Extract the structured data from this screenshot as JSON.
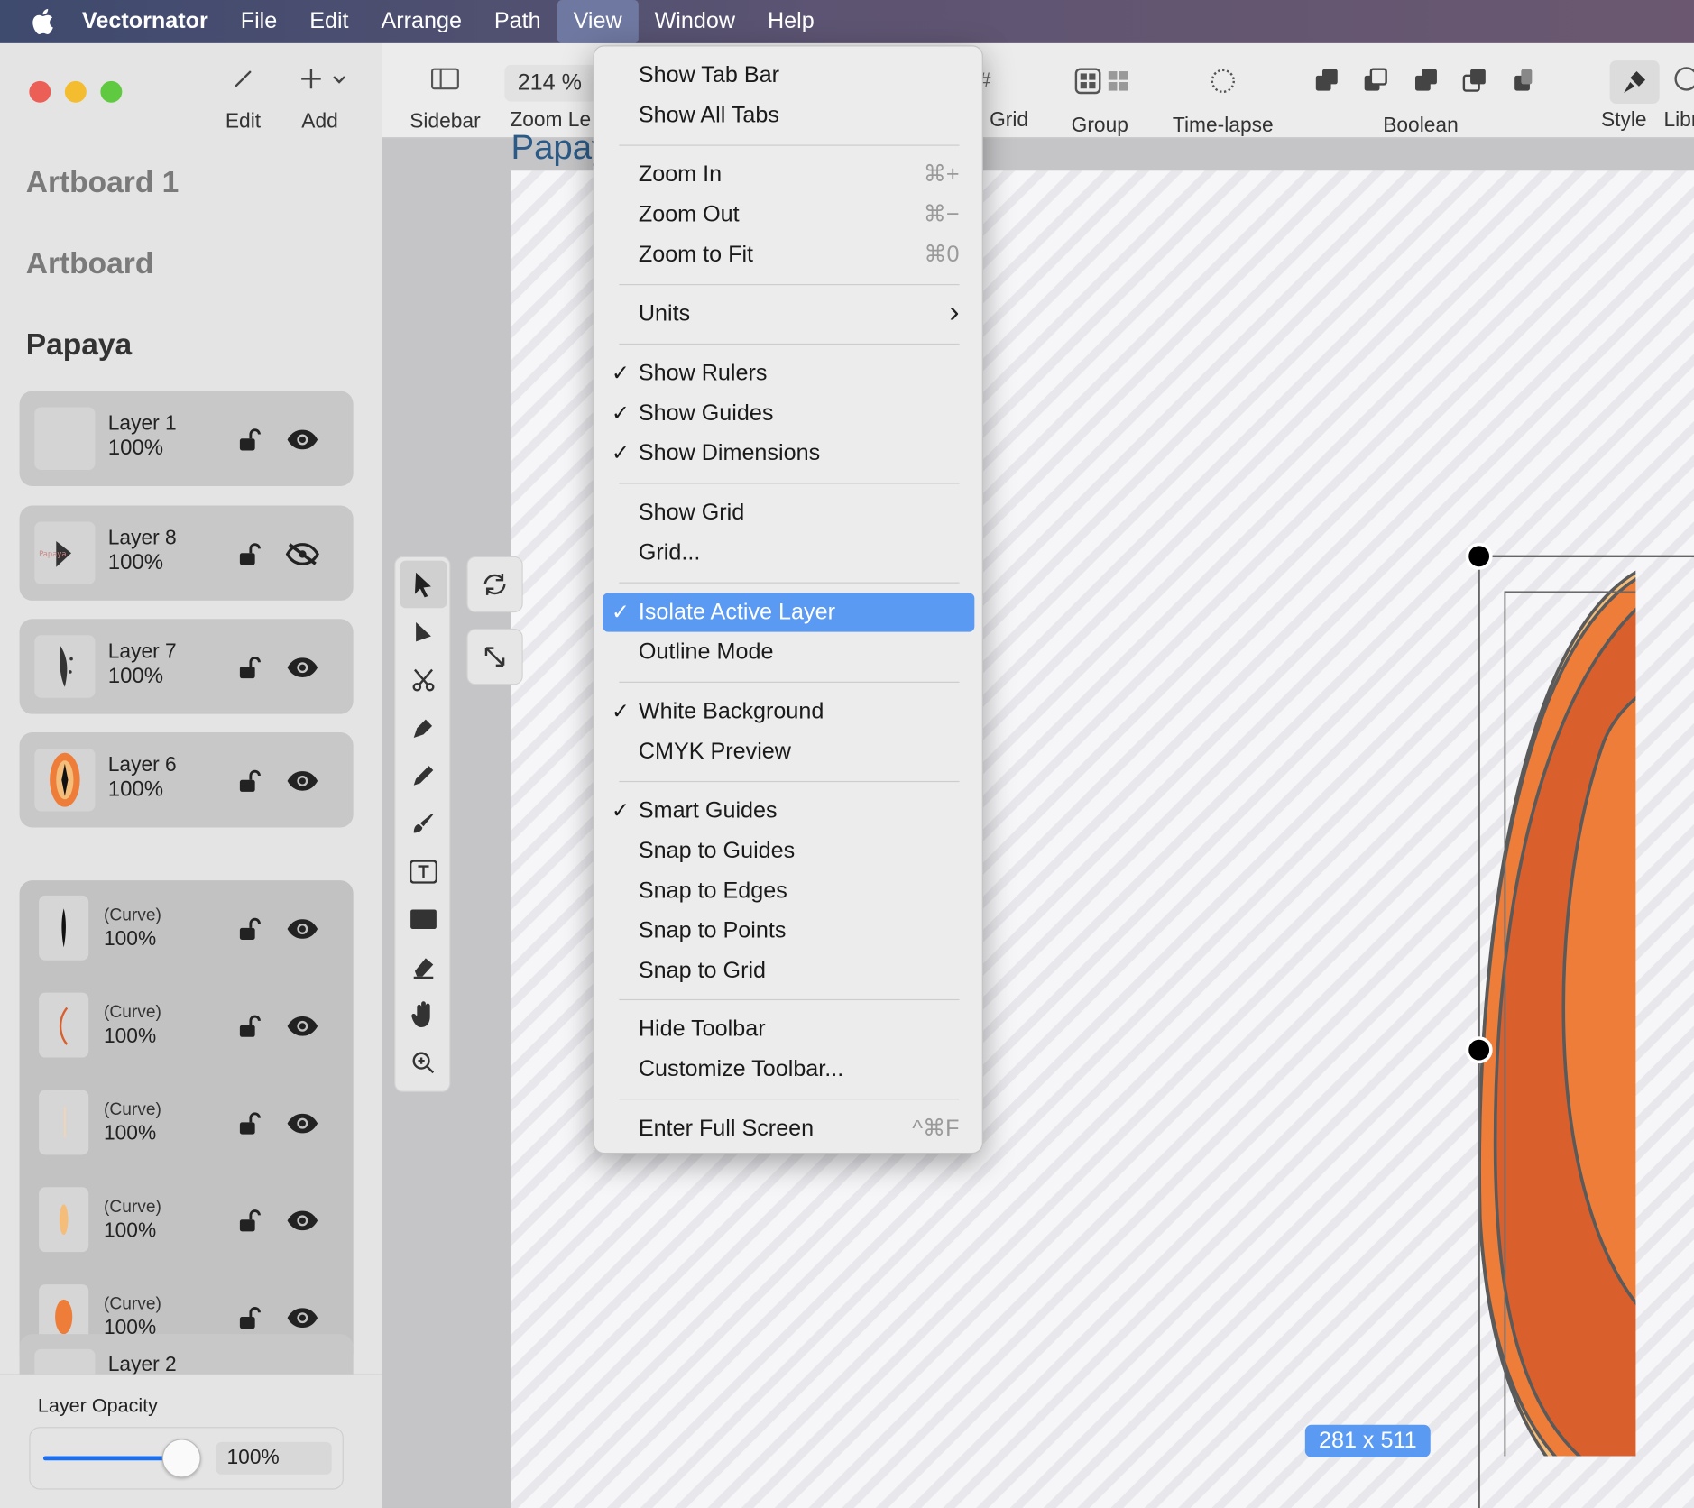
{
  "menubar": {
    "app_name": "Vectornator",
    "items": [
      "File",
      "Edit",
      "Arrange",
      "Path",
      "View",
      "Window",
      "Help"
    ],
    "active": "View"
  },
  "sidebar": {
    "edit_label": "Edit",
    "add_label": "Add",
    "sections": [
      "Artboard 1",
      "Artboard",
      "Papaya"
    ],
    "layers": [
      {
        "name": "Layer 1",
        "opacity": "100%",
        "visible": true
      },
      {
        "name": "Layer 8",
        "opacity": "100%",
        "visible": false
      },
      {
        "name": "Layer 7",
        "opacity": "100%",
        "visible": true
      },
      {
        "name": "Layer 6",
        "opacity": "100%",
        "visible": true
      }
    ],
    "curves": [
      {
        "name": "(Curve)",
        "opacity": "100%"
      },
      {
        "name": "(Curve)",
        "opacity": "100%"
      },
      {
        "name": "(Curve)",
        "opacity": "100%"
      },
      {
        "name": "(Curve)",
        "opacity": "100%"
      },
      {
        "name": "(Curve)",
        "opacity": "100%"
      }
    ],
    "partial_layer": "Layer 2",
    "opacity_panel": {
      "label": "Layer Opacity",
      "value": "100%",
      "level": 1.0
    }
  },
  "toolbar": {
    "sidebar": "Sidebar",
    "zoom_value": "214 %",
    "zoom_label": "Zoom Le",
    "grid": "Grid",
    "group": "Group",
    "timelapse": "Time-lapse",
    "boolean": "Boolean",
    "style": "Style",
    "library": "Libr"
  },
  "canvas": {
    "artboard_title": "Papay",
    "dimension_badge": "281 x 511"
  },
  "view_menu": {
    "items": [
      {
        "label": "Show Tab Bar",
        "checked": false,
        "shortcut": ""
      },
      {
        "label": "Show All Tabs",
        "checked": false,
        "shortcut": ""
      },
      {
        "label": "Zoom In",
        "checked": false,
        "shortcut": "⌘+"
      },
      {
        "label": "Zoom Out",
        "checked": false,
        "shortcut": "⌘−"
      },
      {
        "label": "Zoom to Fit",
        "checked": false,
        "shortcut": "⌘0"
      },
      {
        "label": "Units",
        "checked": false,
        "shortcut": "›"
      },
      {
        "label": "Show Rulers",
        "checked": true,
        "shortcut": ""
      },
      {
        "label": "Show Guides",
        "checked": true,
        "shortcut": ""
      },
      {
        "label": "Show Dimensions",
        "checked": true,
        "shortcut": ""
      },
      {
        "label": "Show Grid",
        "checked": false,
        "shortcut": ""
      },
      {
        "label": "Grid...",
        "checked": false,
        "shortcut": ""
      },
      {
        "label": "Isolate Active Layer",
        "checked": true,
        "shortcut": "",
        "highlighted": true
      },
      {
        "label": "Outline Mode",
        "checked": false,
        "shortcut": ""
      },
      {
        "label": "White Background",
        "checked": true,
        "shortcut": ""
      },
      {
        "label": "CMYK Preview",
        "checked": false,
        "shortcut": ""
      },
      {
        "label": "Smart Guides",
        "checked": true,
        "shortcut": ""
      },
      {
        "label": "Snap to Guides",
        "checked": false,
        "shortcut": ""
      },
      {
        "label": "Snap to Edges",
        "checked": false,
        "shortcut": ""
      },
      {
        "label": "Snap to Points",
        "checked": false,
        "shortcut": ""
      },
      {
        "label": "Snap to Grid",
        "checked": false,
        "shortcut": ""
      },
      {
        "label": "Hide Toolbar",
        "checked": false,
        "shortcut": ""
      },
      {
        "label": "Customize Toolbar...",
        "checked": false,
        "shortcut": ""
      },
      {
        "label": "Enter Full Screen",
        "checked": false,
        "shortcut": "^⌘F"
      }
    ],
    "check_glyph": "✓"
  },
  "colors": {
    "accent": "#5b9af2",
    "papaya_dark": "#d95f2d",
    "papaya_orange": "#ee7d3a",
    "papaya_light": "#f4bd7a",
    "seeds": "#0d0a06",
    "handle_orange": "#f29a2e"
  }
}
